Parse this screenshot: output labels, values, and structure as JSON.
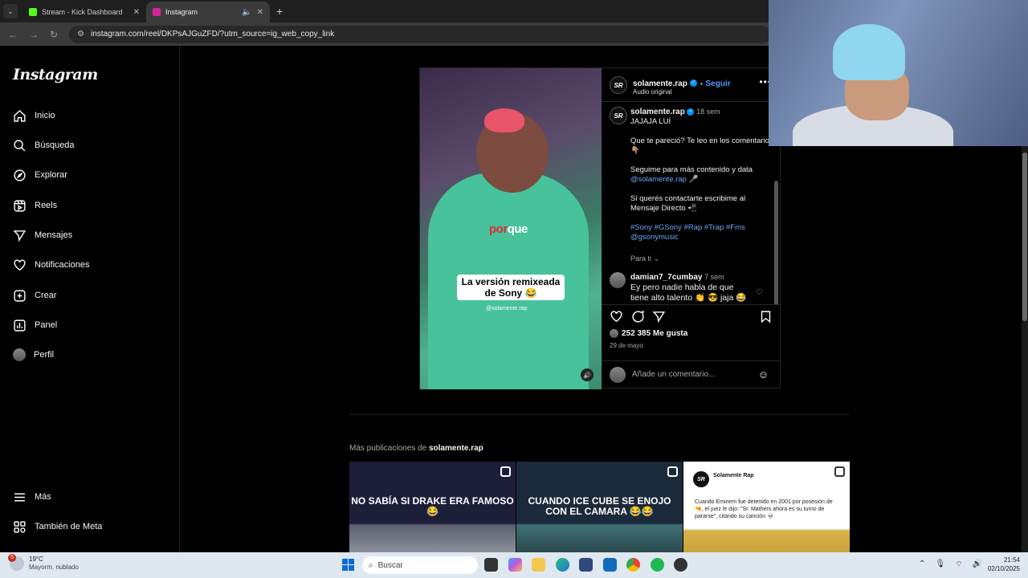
{
  "browser": {
    "tabs": [
      {
        "title": "Stream - Kick Dashboard",
        "color": "#53fc18",
        "active": false
      },
      {
        "title": "Instagram",
        "color": "#d6249f",
        "active": true
      }
    ],
    "url": "instagram.com/reel/DKPsAJGuZFD/?utm_source=ig_web_copy_link"
  },
  "sidebar": {
    "logo": "Instagram",
    "items": [
      {
        "label": "Inicio",
        "icon": "home-icon"
      },
      {
        "label": "Búsqueda",
        "icon": "search-icon"
      },
      {
        "label": "Explorar",
        "icon": "compass-icon"
      },
      {
        "label": "Reels",
        "icon": "reels-icon"
      },
      {
        "label": "Mensajes",
        "icon": "messages-icon"
      },
      {
        "label": "Notificaciones",
        "icon": "heart-icon"
      },
      {
        "label": "Crear",
        "icon": "plus-icon"
      },
      {
        "label": "Panel",
        "icon": "chart-icon"
      },
      {
        "label": "Perfil",
        "icon": "avatar"
      }
    ],
    "bottom": [
      {
        "label": "Más",
        "icon": "menu-icon"
      },
      {
        "label": "También de Meta",
        "icon": "meta-icon"
      }
    ]
  },
  "video": {
    "overlay_word_red": "por",
    "overlay_word_white": "que",
    "caption": "La versión remixeada de Sony 😂",
    "watermark": "@solamente.rap"
  },
  "post": {
    "avatar_text": "SR",
    "username": "solamente.rap",
    "follow": "Seguir",
    "audio": "Audio original",
    "time": "18 sem",
    "body": {
      "line1": "JAJAJA LUÍ",
      "p1": "Que te pareció? Te leo en los comentarios 👇🏽",
      "p2a": "Seguime para más contenido y data",
      "p2b": "@solamente.rap",
      "p3": "Si querés contactarte escribime al Mensaje Directo 📲",
      "tags": "#Sony #GSony #Rap #Trap #Fms @gsonymusic",
      "for_you": "Para ti"
    },
    "comment": {
      "user": "damian7_7cumbay",
      "time": "7 sem",
      "text": "Ey pero nadie habla de que tiene alto talento 👏 😎 jaja 😂"
    },
    "likes": "252 385 Me gusta",
    "date": "29 de mayo",
    "add_comment_placeholder": "Añade un comentario..."
  },
  "more": {
    "prefix": "Más publicaciones de",
    "user": "solamente.rap",
    "thumbs": [
      {
        "text": "NO SABÍA SI DRAKE ERA FAMOSO 😂"
      },
      {
        "text": "CUANDO ICE CUBE SE ENOJO CON EL CAMARA 😂😂"
      },
      {
        "author": "Solamente Rap",
        "text": "Cuando Eminem fue detenido en 2001 por posesión de 🔫, el juez le dijo: \"Sr. Mathers ahora es su turno de pararse\", citando su canción 💀"
      }
    ]
  },
  "taskbar": {
    "weather_temp": "19°C",
    "weather_desc": "Mayorm. nublado",
    "weather_badge": "5",
    "search": "Buscar",
    "time": "21:54",
    "date": "02/10/2025"
  }
}
